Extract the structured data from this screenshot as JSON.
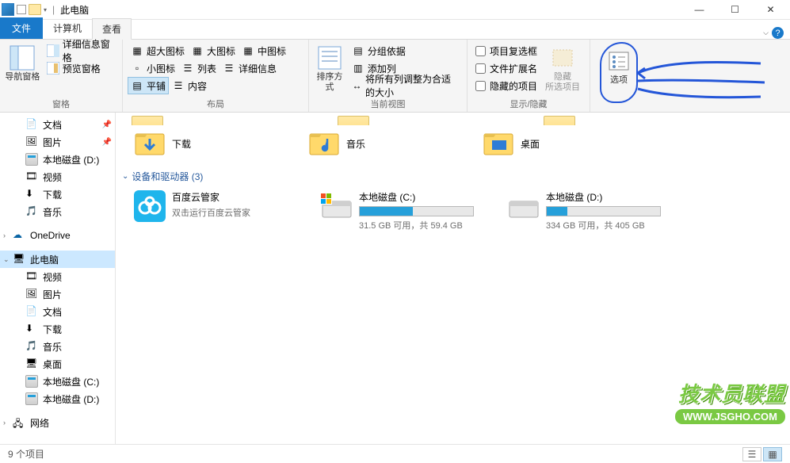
{
  "window": {
    "title": "此电脑"
  },
  "tabs": {
    "file": "文件",
    "computer": "计算机",
    "view": "查看"
  },
  "ribbon": {
    "panes_group": "窗格",
    "nav_pane": "导航窗格",
    "detail_pane": "详细信息窗格",
    "preview_pane": "预览窗格",
    "layout_group": "布局",
    "extra_large": "超大图标",
    "large": "大图标",
    "medium": "中图标",
    "small": "小图标",
    "list": "列表",
    "details": "详细信息",
    "tiles": "平铺",
    "content": "内容",
    "current_view_group": "当前视图",
    "sort_by": "排序方式",
    "group_by": "分组依据",
    "add_columns": "添加列",
    "size_all": "将所有列调整为合适的大小",
    "show_hide_group": "显示/隐藏",
    "item_checkboxes": "项目复选框",
    "file_ext": "文件扩展名",
    "hidden_items": "隐藏的项目",
    "hide_selected": "隐藏\n所选项目",
    "options": "选项"
  },
  "sidebar": {
    "documents": "文档",
    "pictures": "图片",
    "local_d": "本地磁盘 (D:)",
    "videos": "视频",
    "downloads": "下载",
    "music": "音乐",
    "onedrive": "OneDrive",
    "this_pc": "此电脑",
    "videos2": "视频",
    "pictures2": "图片",
    "documents2": "文档",
    "downloads2": "下载",
    "music2": "音乐",
    "desktop": "桌面",
    "local_c": "本地磁盘 (C:)",
    "local_d2": "本地磁盘 (D:)",
    "network": "网络"
  },
  "main": {
    "folders": {
      "downloads": "下载",
      "music": "音乐",
      "desktop": "桌面"
    },
    "devices_header": "设备和驱动器 (3)",
    "baidu": {
      "name": "百度云管家",
      "sub": "双击运行百度云管家"
    },
    "drive_c": {
      "name": "本地磁盘 (C:)",
      "sub": "31.5 GB 可用，共 59.4 GB",
      "fill_pct": 47
    },
    "drive_d": {
      "name": "本地磁盘 (D:)",
      "sub": "334 GB 可用，共 405 GB",
      "fill_pct": 18
    }
  },
  "status": {
    "count": "9 个项目"
  },
  "watermark": {
    "line1": "技术员联盟",
    "line2": "WWW.JSGHO.COM"
  }
}
